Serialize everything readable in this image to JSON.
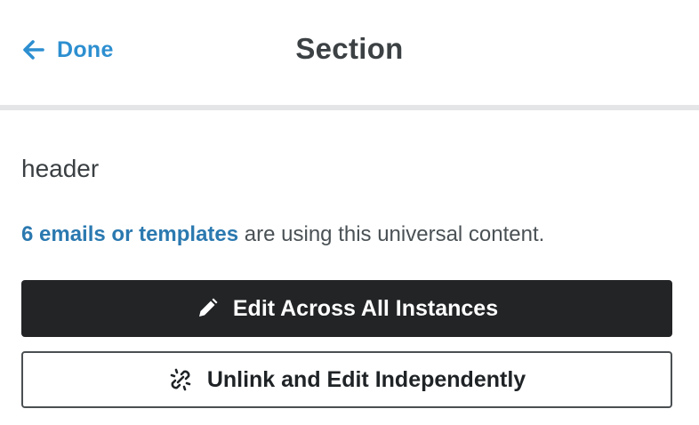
{
  "header": {
    "back_label": "Done",
    "back_icon": "arrow-left-icon",
    "title": "Section"
  },
  "content": {
    "name": "header",
    "usage_link_text": "6 emails or templates",
    "usage_suffix": " are using this universal content."
  },
  "actions": {
    "edit_all_label": "Edit Across All Instances",
    "edit_all_icon": "pencil-icon",
    "unlink_label": "Unlink and Edit Independently",
    "unlink_icon": "unlink-icon"
  },
  "colors": {
    "link_blue": "#2d8fd0",
    "primary_button_bg": "#222426",
    "text_dark": "#3c4144"
  }
}
